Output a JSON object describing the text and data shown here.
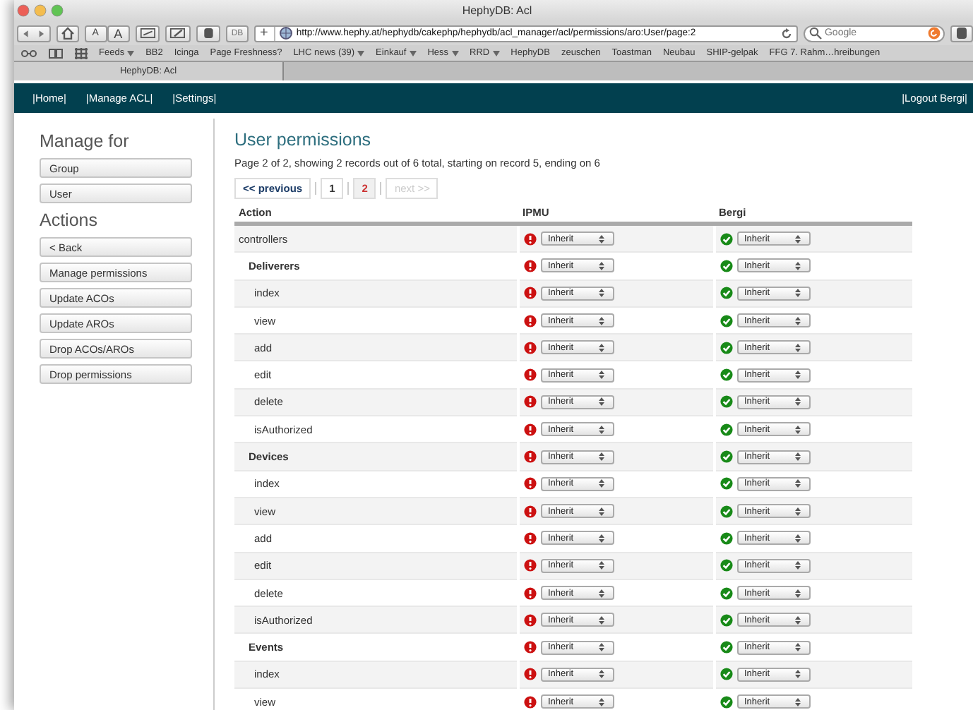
{
  "window": {
    "title": "HephyDB: Acl"
  },
  "toolbar": {
    "text_buttons": [
      "A",
      "A"
    ],
    "db_button": "DB",
    "add_button": "+",
    "url": "http://www.hephy.at/hephydb/cakephp/hephydb/acl_manager/acl/permissions/aro:User/page:2",
    "search": {
      "placeholder": "Google"
    }
  },
  "bookmarks": [
    {
      "label": "Feeds",
      "menu": true
    },
    {
      "label": "BB2",
      "menu": false
    },
    {
      "label": "Icinga",
      "menu": false
    },
    {
      "label": "Page Freshness?",
      "menu": false
    },
    {
      "label": "LHC news (39)",
      "menu": true
    },
    {
      "label": "Einkauf",
      "menu": true
    },
    {
      "label": "Hess",
      "menu": true
    },
    {
      "label": "RRD",
      "menu": true
    },
    {
      "label": "HephyDB",
      "menu": false
    },
    {
      "label": "zeuschen",
      "menu": false
    },
    {
      "label": "Toastman",
      "menu": false
    },
    {
      "label": "Neubau",
      "menu": false
    },
    {
      "label": "SHIP-gelpak",
      "menu": false
    },
    {
      "label": "FFG 7. Rahm…hreibungen",
      "menu": false
    }
  ],
  "tabs": [
    {
      "label": "HephyDB: Acl",
      "selected": true
    }
  ],
  "nav": {
    "links": [
      "|Home|",
      "|Manage ACL|",
      "|Settings|"
    ],
    "logout": "|Logout Bergi|"
  },
  "sidebar": {
    "manage_heading": "Manage for",
    "manage_buttons": [
      "Group",
      "User"
    ],
    "actions_heading": "Actions",
    "action_buttons": [
      "< Back",
      "Manage permissions",
      "Update ACOs",
      "Update AROs",
      "Drop ACOs/AROs",
      "Drop permissions"
    ]
  },
  "main": {
    "title": "User permissions",
    "summary": "Page 2 of 2, showing 2 records out of 6 total, starting on record 5, ending on 6",
    "pagination": [
      {
        "label": "<< previous",
        "kind": "link",
        "selected": false,
        "disabled": false
      },
      {
        "label": "1",
        "kind": "page",
        "selected": false,
        "disabled": false
      },
      {
        "label": "2",
        "kind": "page",
        "selected": true,
        "disabled": false
      },
      {
        "label": "next >>",
        "kind": "link",
        "selected": false,
        "disabled": true
      }
    ],
    "table": {
      "columns": [
        "Action",
        "IPMU",
        "Bergi"
      ],
      "rows": [
        {
          "cells": [
            {
              "kind": "action",
              "text": "controllers"
            },
            {
              "kind": "select",
              "allowed": false,
              "value": "Inherit"
            },
            {
              "kind": "select",
              "allowed": true,
              "value": "Inherit"
            }
          ],
          "children": [
            {
              "cells": [
                {
                  "kind": "action",
                  "text": "Deliverers"
                },
                {
                  "kind": "select",
                  "allowed": false,
                  "value": "Inherit"
                },
                {
                  "kind": "select",
                  "allowed": true,
                  "value": "Inherit"
                }
              ],
              "children": [
                {
                  "cells": [
                    {
                      "kind": "action",
                      "text": "index"
                    },
                    {
                      "kind": "select",
                      "allowed": false,
                      "value": "Inherit"
                    },
                    {
                      "kind": "select",
                      "allowed": true,
                      "value": "Inherit"
                    }
                  ]
                },
                {
                  "cells": [
                    {
                      "kind": "action",
                      "text": "view"
                    },
                    {
                      "kind": "select",
                      "allowed": false,
                      "value": "Inherit"
                    },
                    {
                      "kind": "select",
                      "allowed": true,
                      "value": "Inherit"
                    }
                  ]
                },
                {
                  "cells": [
                    {
                      "kind": "action",
                      "text": "add"
                    },
                    {
                      "kind": "select",
                      "allowed": false,
                      "value": "Inherit"
                    },
                    {
                      "kind": "select",
                      "allowed": true,
                      "value": "Inherit"
                    }
                  ]
                },
                {
                  "cells": [
                    {
                      "kind": "action",
                      "text": "edit"
                    },
                    {
                      "kind": "select",
                      "allowed": false,
                      "value": "Inherit"
                    },
                    {
                      "kind": "select",
                      "allowed": true,
                      "value": "Inherit"
                    }
                  ]
                },
                {
                  "cells": [
                    {
                      "kind": "action",
                      "text": "delete"
                    },
                    {
                      "kind": "select",
                      "allowed": false,
                      "value": "Inherit"
                    },
                    {
                      "kind": "select",
                      "allowed": true,
                      "value": "Inherit"
                    }
                  ]
                },
                {
                  "cells": [
                    {
                      "kind": "action",
                      "text": "isAuthorized"
                    },
                    {
                      "kind": "select",
                      "allowed": false,
                      "value": "Inherit"
                    },
                    {
                      "kind": "select",
                      "allowed": true,
                      "value": "Inherit"
                    }
                  ]
                }
              ]
            },
            {
              "cells": [
                {
                  "kind": "action",
                  "text": "Devices"
                },
                {
                  "kind": "select",
                  "allowed": false,
                  "value": "Inherit"
                },
                {
                  "kind": "select",
                  "allowed": true,
                  "value": "Inherit"
                }
              ],
              "children": [
                {
                  "cells": [
                    {
                      "kind": "action",
                      "text": "index"
                    },
                    {
                      "kind": "select",
                      "allowed": false,
                      "value": "Inherit"
                    },
                    {
                      "kind": "select",
                      "allowed": true,
                      "value": "Inherit"
                    }
                  ]
                },
                {
                  "cells": [
                    {
                      "kind": "action",
                      "text": "view"
                    },
                    {
                      "kind": "select",
                      "allowed": false,
                      "value": "Inherit"
                    },
                    {
                      "kind": "select",
                      "allowed": true,
                      "value": "Inherit"
                    }
                  ]
                },
                {
                  "cells": [
                    {
                      "kind": "action",
                      "text": "add"
                    },
                    {
                      "kind": "select",
                      "allowed": false,
                      "value": "Inherit"
                    },
                    {
                      "kind": "select",
                      "allowed": true,
                      "value": "Inherit"
                    }
                  ]
                },
                {
                  "cells": [
                    {
                      "kind": "action",
                      "text": "edit"
                    },
                    {
                      "kind": "select",
                      "allowed": false,
                      "value": "Inherit"
                    },
                    {
                      "kind": "select",
                      "allowed": true,
                      "value": "Inherit"
                    }
                  ]
                },
                {
                  "cells": [
                    {
                      "kind": "action",
                      "text": "delete"
                    },
                    {
                      "kind": "select",
                      "allowed": false,
                      "value": "Inherit"
                    },
                    {
                      "kind": "select",
                      "allowed": true,
                      "value": "Inherit"
                    }
                  ]
                },
                {
                  "cells": [
                    {
                      "kind": "action",
                      "text": "isAuthorized"
                    },
                    {
                      "kind": "select",
                      "allowed": false,
                      "value": "Inherit"
                    },
                    {
                      "kind": "select",
                      "allowed": true,
                      "value": "Inherit"
                    }
                  ]
                }
              ]
            },
            {
              "cells": [
                {
                  "kind": "action",
                  "text": "Events"
                },
                {
                  "kind": "select",
                  "allowed": false,
                  "value": "Inherit"
                },
                {
                  "kind": "select",
                  "allowed": true,
                  "value": "Inherit"
                }
              ],
              "children": [
                {
                  "cells": [
                    {
                      "kind": "action",
                      "text": "index"
                    },
                    {
                      "kind": "select",
                      "allowed": false,
                      "value": "Inherit"
                    },
                    {
                      "kind": "select",
                      "allowed": true,
                      "value": "Inherit"
                    }
                  ]
                },
                {
                  "cells": [
                    {
                      "kind": "action",
                      "text": "view"
                    },
                    {
                      "kind": "select",
                      "allowed": false,
                      "value": "Inherit"
                    },
                    {
                      "kind": "select",
                      "allowed": true,
                      "value": "Inherit"
                    }
                  ]
                }
              ]
            }
          ]
        }
      ]
    }
  }
}
